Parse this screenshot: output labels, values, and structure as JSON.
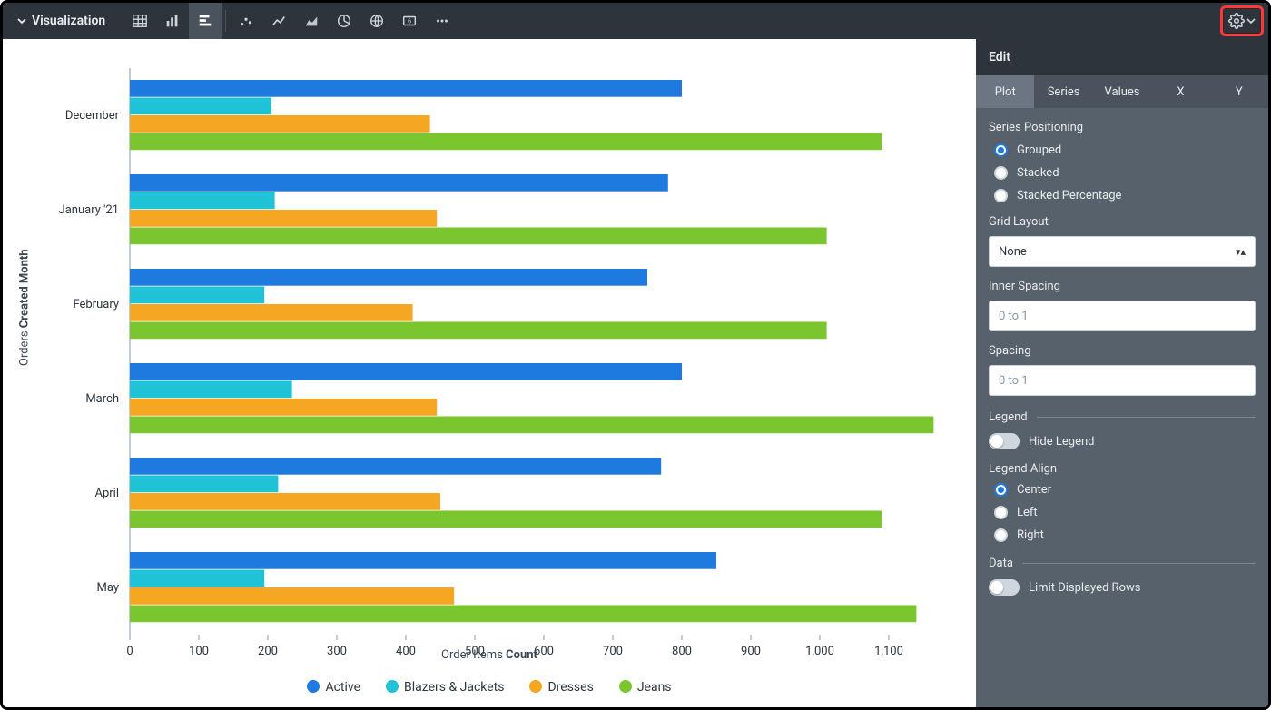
{
  "toolbar": {
    "title": "Visualization",
    "icons": [
      "table-icon",
      "column-chart-icon",
      "bar-chart-icon",
      "scatter-chart-icon",
      "line-chart-icon",
      "area-chart-icon",
      "pie-chart-icon",
      "map-icon",
      "single-value-icon",
      "more-icon"
    ],
    "active_icon_index": 2
  },
  "edit": {
    "header": "Edit",
    "tabs": [
      "Plot",
      "Series",
      "Values",
      "X",
      "Y"
    ],
    "active_tab_index": 0,
    "series_positioning": {
      "title": "Series Positioning",
      "options": [
        "Grouped",
        "Stacked",
        "Stacked Percentage"
      ],
      "selected_index": 0
    },
    "grid_layout": {
      "label": "Grid Layout",
      "value": "None"
    },
    "inner_spacing": {
      "label": "Inner Spacing",
      "placeholder": "0 to 1",
      "value": ""
    },
    "spacing": {
      "label": "Spacing",
      "placeholder": "0 to 1",
      "value": ""
    },
    "legend_section": "Legend",
    "hide_legend": {
      "label": "Hide Legend",
      "on": false
    },
    "legend_align": {
      "label": "Legend Align",
      "options": [
        "Center",
        "Left",
        "Right"
      ],
      "selected_index": 0
    },
    "data_section": "Data",
    "limit_rows": {
      "label": "Limit Displayed Rows",
      "on": false
    }
  },
  "chart_data": {
    "type": "bar",
    "orientation": "horizontal",
    "xlabel": "Order Items Count",
    "ylabel": "Orders Created Month",
    "xlim": [
      0,
      1200
    ],
    "xticks": [
      0,
      100,
      200,
      300,
      400,
      500,
      600,
      700,
      800,
      900,
      1000,
      1100
    ],
    "categories": [
      "December",
      "January '21",
      "February",
      "March",
      "April",
      "May"
    ],
    "series": [
      {
        "name": "Active",
        "color": "#1f7ae0",
        "values": [
          800,
          780,
          750,
          800,
          770,
          850
        ]
      },
      {
        "name": "Blazers & Jackets",
        "color": "#1fc2d6",
        "values": [
          205,
          210,
          195,
          235,
          215,
          195
        ]
      },
      {
        "name": "Dresses",
        "color": "#f5a623",
        "values": [
          435,
          445,
          410,
          445,
          450,
          470
        ]
      },
      {
        "name": "Jeans",
        "color": "#7bc62e",
        "values": [
          1090,
          1010,
          1010,
          1165,
          1090,
          1140
        ]
      }
    ]
  },
  "legend": [
    {
      "label": "Active",
      "color": "#1f7ae0"
    },
    {
      "label": "Blazers & Jackets",
      "color": "#1fc2d6"
    },
    {
      "label": "Dresses",
      "color": "#f5a623"
    },
    {
      "label": "Jeans",
      "color": "#7bc62e"
    }
  ],
  "xtitle_words": {
    "a": "Order Items ",
    "b": "Count"
  },
  "ytitle_words": {
    "a": "Orders ",
    "b": "Created Month"
  }
}
